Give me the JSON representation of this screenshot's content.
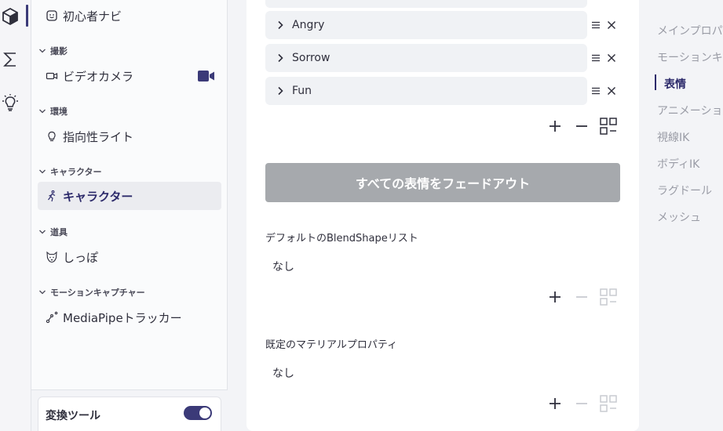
{
  "colors": {
    "accent": "#3b3a78",
    "button_disabled": "#a6a9ad",
    "muted_text": "#9a9ca6"
  },
  "rail": {
    "icons": [
      "cube-icon",
      "sigma-icon",
      "lightbulb-icon"
    ]
  },
  "tree": {
    "item_navi": "初心者ナビ",
    "group_shooting": "撮影",
    "item_camera": "ビデオカメラ",
    "group_environment": "環境",
    "item_light": "指向性ライト",
    "group_character": "キャラクター",
    "item_character": "キャラクター",
    "group_props": "道具",
    "item_tail": "しっぽ",
    "group_mocap": "モーションキャプチャー",
    "item_mediapipe": "MediaPipeトラッカー",
    "tool_label": "変換ツール"
  },
  "main": {
    "expressions": [
      "Angry",
      "Sorrow",
      "Fun"
    ],
    "fade_button": "すべての表情をフェードアウト",
    "blendshape_label": "デフォルトのBlendShapeリスト",
    "blendshape_value": "なし",
    "material_label": "既定のマテリアルプロパティ",
    "material_value": "なし"
  },
  "toc": {
    "items": [
      "メインプロパティ",
      "モーションキャプチャー",
      "表情",
      "アニメーション",
      "視線IK",
      "ボディIK",
      "ラグドール",
      "メッシュ"
    ],
    "active_index": 2
  }
}
